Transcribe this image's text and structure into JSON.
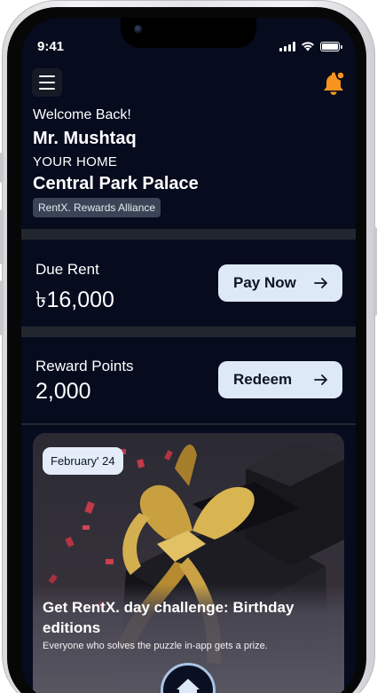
{
  "status_bar": {
    "time": "9:41",
    "icons": [
      "cellular-signal-icon",
      "wifi-icon",
      "battery-icon"
    ]
  },
  "header": {
    "menu_icon": "hamburger-menu-icon",
    "notification_icon": "bell-notification-icon",
    "accent_color": "#f7931e"
  },
  "welcome": {
    "greeting": "Welcome Back!",
    "user_name": "Mr. Mushtaq",
    "home_label": "YOUR HOME",
    "home_name": "Central Park Palace",
    "badge": "RentX. Rewards Alliance"
  },
  "rent": {
    "label": "Due Rent",
    "value": "৳16,000",
    "button_label": "Pay Now",
    "button_icon": "arrow-right-icon"
  },
  "rewards": {
    "label": "Reward Points",
    "value": "2,000",
    "button_label": "Redeem",
    "button_icon": "arrow-right-icon"
  },
  "promo": {
    "date": "February' 24",
    "title": "Get RentX. day challenge: Birthday editions",
    "subtitle": "Everyone who solves the puzzle in-app gets a prize.",
    "image": "gift-box-with-gold-ribbon-illustration"
  },
  "bottom_nav": {
    "home_icon": "home-icon"
  },
  "colors": {
    "background": "#060b1e",
    "button_bg": "#dde9f7",
    "divider": "#22272f"
  }
}
